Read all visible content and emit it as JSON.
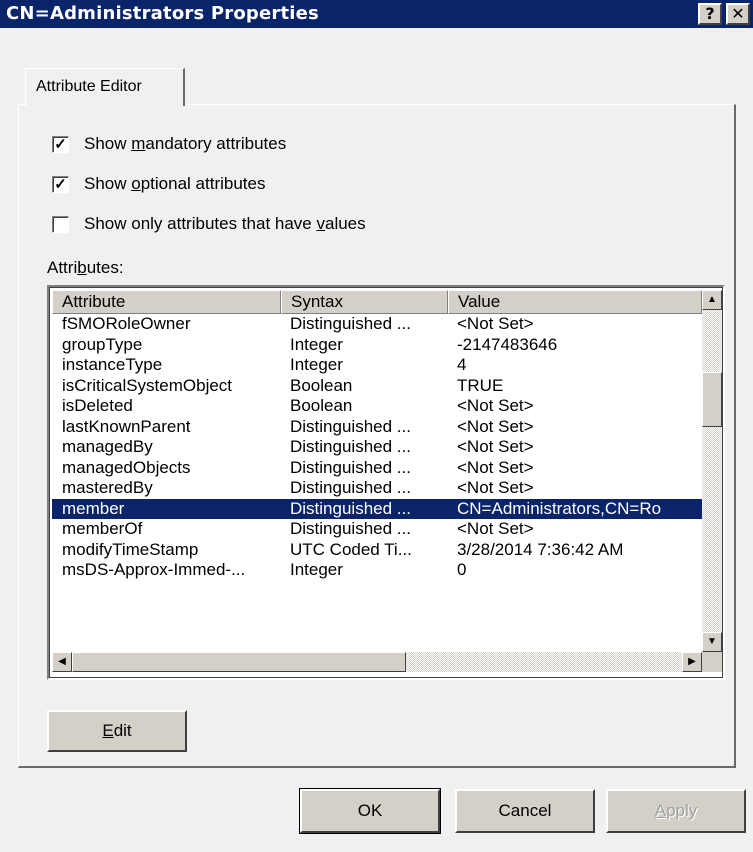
{
  "window": {
    "title": "CN=Administrators Properties",
    "help_label": "?",
    "close_label": "✕"
  },
  "tabs": [
    {
      "label": "Attribute Editor"
    }
  ],
  "options": {
    "mandatory": {
      "pre": "Show ",
      "key": "m",
      "post": "andatory attributes",
      "checked": true,
      "mark": "✓"
    },
    "optional": {
      "pre": "Show ",
      "key": "o",
      "post": "ptional attributes",
      "checked": true,
      "mark": "✓"
    },
    "only_values": {
      "pre": "Show only attributes that have ",
      "key": "v",
      "post": "alues",
      "checked": false,
      "mark": ""
    }
  },
  "attributes_label": {
    "pre": "Attri",
    "key": "b",
    "post": "utes:"
  },
  "table": {
    "columns": [
      "Attribute",
      "Syntax",
      "Value"
    ],
    "rows": [
      [
        "fSMORoleOwner",
        "Distinguished ...",
        "<Not Set>"
      ],
      [
        "groupType",
        "Integer",
        "-2147483646"
      ],
      [
        "instanceType",
        "Integer",
        "4"
      ],
      [
        "isCriticalSystemObject",
        "Boolean",
        "TRUE"
      ],
      [
        "isDeleted",
        "Boolean",
        "<Not Set>"
      ],
      [
        "lastKnownParent",
        "Distinguished ...",
        "<Not Set>"
      ],
      [
        "managedBy",
        "Distinguished ...",
        "<Not Set>"
      ],
      [
        "managedObjects",
        "Distinguished ...",
        "<Not Set>"
      ],
      [
        "masteredBy",
        "Distinguished ...",
        "<Not Set>"
      ],
      [
        "member",
        "Distinguished ...",
        "CN=Administrators,CN=Ro"
      ],
      [
        "memberOf",
        "Distinguished ...",
        "<Not Set>"
      ],
      [
        "modifyTimeStamp",
        "UTC Coded Ti...",
        "3/28/2014 7:36:42 AM"
      ],
      [
        "msDS-Approx-Immed-...",
        "Integer",
        "0"
      ]
    ],
    "selected_row": "member"
  },
  "buttons": {
    "edit": {
      "key": "E",
      "post": "dit"
    },
    "ok": "OK",
    "cancel": "Cancel",
    "apply": {
      "key": "A",
      "post": "pply"
    }
  },
  "icons": {
    "scroll_up": "arrow-up-icon",
    "scroll_down": "arrow-down-icon",
    "scroll_left": "arrow-left-icon",
    "scroll_right": "arrow-right-icon"
  },
  "colors": {
    "titlebar": "#0a246a",
    "selection": "#0a246a",
    "face": "#d4d0c8"
  }
}
